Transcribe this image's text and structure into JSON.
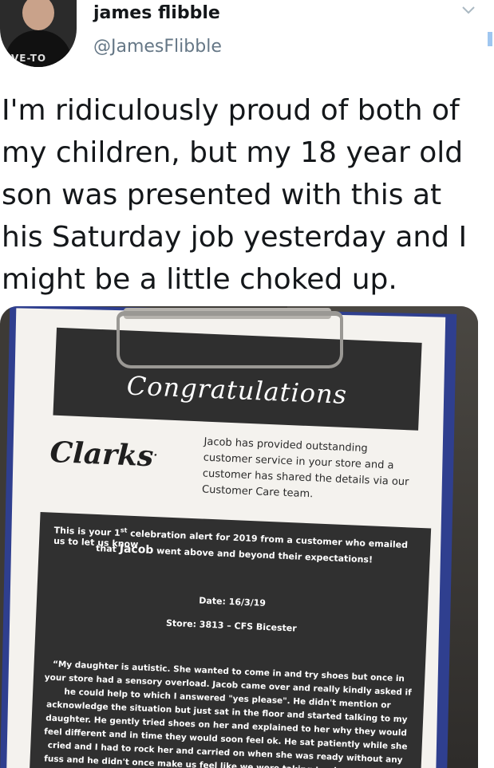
{
  "header": {
    "display_name": "james flibble",
    "handle": "@JamesFlibble",
    "avatar_shirt_text": "VE-TO",
    "menu_icon": "chevron-down-icon"
  },
  "tweet": {
    "text": "I'm ridiculously proud of both of my children, but my 18 year old son was presented with this at his Saturday job yesterday and I might be a little choked up."
  },
  "photo": {
    "banner_title": "Congratulations",
    "brand": "Clarks",
    "brand_mark": ".",
    "intro": "Jacob has provided outstanding customer service in your store and a customer has shared the details via our Customer Care team.",
    "alert_prefix": "This is your 1",
    "alert_sup": "st",
    "alert_rest": " celebration alert for 2019 from a customer who emailed us to let us know",
    "alert_that": "that ",
    "alert_name": "Jacob",
    "alert_end": " went above and beyond their expectations!",
    "date": "Date: 16/3/19",
    "store": "Store: 3813 – CFS Bicester",
    "quote": "“My daughter is autistic.  She wanted to come in and try shoes but once in your store had a sensory overload.  Jacob came over and really kindly asked if he could help to which I answered \"yes please\".  He didn't mention or acknowledge the situation but just sat in the floor and started talking to my daughter.  He gently tried shoes on her and explained to her why they would feel different and in time they would soon feel ok.  He sat patiently while she cried and I had to rock her and carried on when she was ready without any fuss and he didn't once make us feel like we were taking too long or being a nuisance. ”"
  },
  "colors": {
    "text_primary": "#14171a",
    "text_secondary": "#657786",
    "banner_bg": "#2f2f2f",
    "clipboard_blue": "#2f3f8f"
  }
}
